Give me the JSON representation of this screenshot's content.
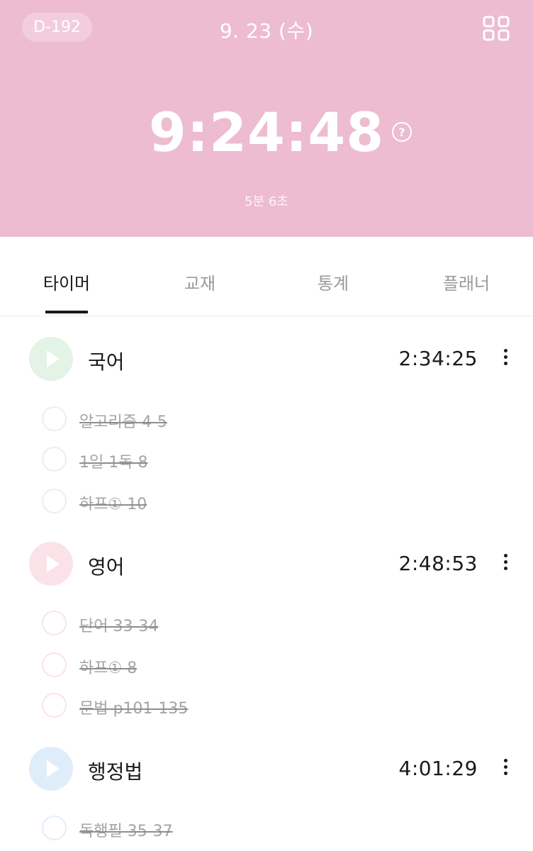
{
  "header": {
    "dday": "D-192",
    "date": "9. 23 (수)",
    "total_time": "9:24:48",
    "help_symbol": "?",
    "sub_time": "5분 6초",
    "background_color": "#edbcd0"
  },
  "tabs": [
    {
      "label": "타이머",
      "active": true
    },
    {
      "label": "교재",
      "active": false
    },
    {
      "label": "통계",
      "active": false
    },
    {
      "label": "플래너",
      "active": false
    }
  ],
  "subjects": [
    {
      "name": "국어",
      "time": "2:34:25",
      "color": "#d8f0dc",
      "ring_color": "#e4f3e6",
      "tasks": [
        "알고리즘 4-5",
        "1일 1독 8",
        "하프① 10"
      ]
    },
    {
      "name": "영어",
      "time": "2:48:53",
      "color": "#fbe1e8",
      "ring_color": "#f9e3e9",
      "tasks": [
        "단어 33-34",
        "하프① 8",
        "문법 p101-135"
      ]
    },
    {
      "name": "행정법",
      "time": "4:01:29",
      "color": "#dcebfb",
      "ring_color": "#e1eefb",
      "tasks": [
        "독행필 35-37"
      ]
    }
  ],
  "icons": {
    "grid": "grid-menu-icon",
    "play": "play-icon",
    "more": "more-vertical-icon",
    "help": "help-circle-icon"
  }
}
